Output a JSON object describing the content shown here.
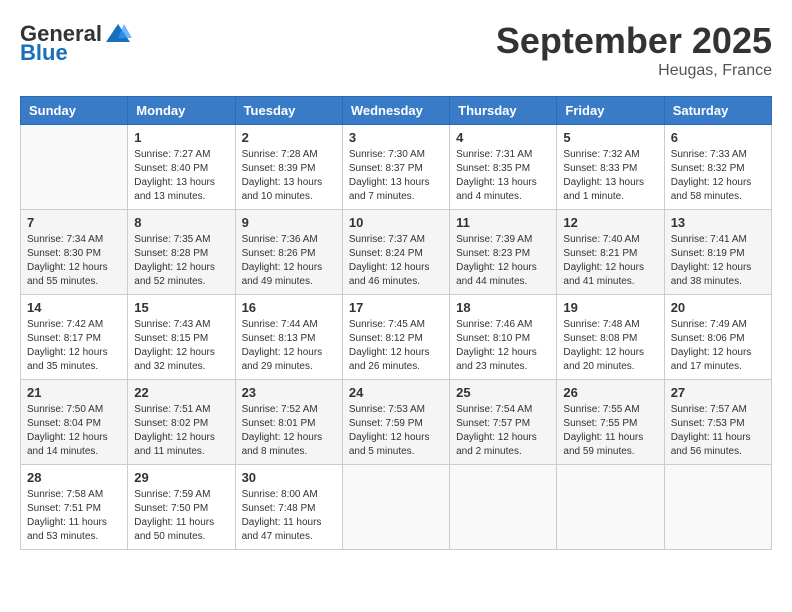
{
  "header": {
    "logo_general": "General",
    "logo_blue": "Blue",
    "month_title": "September 2025",
    "location": "Heugas, France"
  },
  "days_of_week": [
    "Sunday",
    "Monday",
    "Tuesday",
    "Wednesday",
    "Thursday",
    "Friday",
    "Saturday"
  ],
  "weeks": [
    [
      {
        "day": "",
        "info": ""
      },
      {
        "day": "1",
        "info": "Sunrise: 7:27 AM\nSunset: 8:40 PM\nDaylight: 13 hours\nand 13 minutes."
      },
      {
        "day": "2",
        "info": "Sunrise: 7:28 AM\nSunset: 8:39 PM\nDaylight: 13 hours\nand 10 minutes."
      },
      {
        "day": "3",
        "info": "Sunrise: 7:30 AM\nSunset: 8:37 PM\nDaylight: 13 hours\nand 7 minutes."
      },
      {
        "day": "4",
        "info": "Sunrise: 7:31 AM\nSunset: 8:35 PM\nDaylight: 13 hours\nand 4 minutes."
      },
      {
        "day": "5",
        "info": "Sunrise: 7:32 AM\nSunset: 8:33 PM\nDaylight: 13 hours\nand 1 minute."
      },
      {
        "day": "6",
        "info": "Sunrise: 7:33 AM\nSunset: 8:32 PM\nDaylight: 12 hours\nand 58 minutes."
      }
    ],
    [
      {
        "day": "7",
        "info": "Sunrise: 7:34 AM\nSunset: 8:30 PM\nDaylight: 12 hours\nand 55 minutes."
      },
      {
        "day": "8",
        "info": "Sunrise: 7:35 AM\nSunset: 8:28 PM\nDaylight: 12 hours\nand 52 minutes."
      },
      {
        "day": "9",
        "info": "Sunrise: 7:36 AM\nSunset: 8:26 PM\nDaylight: 12 hours\nand 49 minutes."
      },
      {
        "day": "10",
        "info": "Sunrise: 7:37 AM\nSunset: 8:24 PM\nDaylight: 12 hours\nand 46 minutes."
      },
      {
        "day": "11",
        "info": "Sunrise: 7:39 AM\nSunset: 8:23 PM\nDaylight: 12 hours\nand 44 minutes."
      },
      {
        "day": "12",
        "info": "Sunrise: 7:40 AM\nSunset: 8:21 PM\nDaylight: 12 hours\nand 41 minutes."
      },
      {
        "day": "13",
        "info": "Sunrise: 7:41 AM\nSunset: 8:19 PM\nDaylight: 12 hours\nand 38 minutes."
      }
    ],
    [
      {
        "day": "14",
        "info": "Sunrise: 7:42 AM\nSunset: 8:17 PM\nDaylight: 12 hours\nand 35 minutes."
      },
      {
        "day": "15",
        "info": "Sunrise: 7:43 AM\nSunset: 8:15 PM\nDaylight: 12 hours\nand 32 minutes."
      },
      {
        "day": "16",
        "info": "Sunrise: 7:44 AM\nSunset: 8:13 PM\nDaylight: 12 hours\nand 29 minutes."
      },
      {
        "day": "17",
        "info": "Sunrise: 7:45 AM\nSunset: 8:12 PM\nDaylight: 12 hours\nand 26 minutes."
      },
      {
        "day": "18",
        "info": "Sunrise: 7:46 AM\nSunset: 8:10 PM\nDaylight: 12 hours\nand 23 minutes."
      },
      {
        "day": "19",
        "info": "Sunrise: 7:48 AM\nSunset: 8:08 PM\nDaylight: 12 hours\nand 20 minutes."
      },
      {
        "day": "20",
        "info": "Sunrise: 7:49 AM\nSunset: 8:06 PM\nDaylight: 12 hours\nand 17 minutes."
      }
    ],
    [
      {
        "day": "21",
        "info": "Sunrise: 7:50 AM\nSunset: 8:04 PM\nDaylight: 12 hours\nand 14 minutes."
      },
      {
        "day": "22",
        "info": "Sunrise: 7:51 AM\nSunset: 8:02 PM\nDaylight: 12 hours\nand 11 minutes."
      },
      {
        "day": "23",
        "info": "Sunrise: 7:52 AM\nSunset: 8:01 PM\nDaylight: 12 hours\nand 8 minutes."
      },
      {
        "day": "24",
        "info": "Sunrise: 7:53 AM\nSunset: 7:59 PM\nDaylight: 12 hours\nand 5 minutes."
      },
      {
        "day": "25",
        "info": "Sunrise: 7:54 AM\nSunset: 7:57 PM\nDaylight: 12 hours\nand 2 minutes."
      },
      {
        "day": "26",
        "info": "Sunrise: 7:55 AM\nSunset: 7:55 PM\nDaylight: 11 hours\nand 59 minutes."
      },
      {
        "day": "27",
        "info": "Sunrise: 7:57 AM\nSunset: 7:53 PM\nDaylight: 11 hours\nand 56 minutes."
      }
    ],
    [
      {
        "day": "28",
        "info": "Sunrise: 7:58 AM\nSunset: 7:51 PM\nDaylight: 11 hours\nand 53 minutes."
      },
      {
        "day": "29",
        "info": "Sunrise: 7:59 AM\nSunset: 7:50 PM\nDaylight: 11 hours\nand 50 minutes."
      },
      {
        "day": "30",
        "info": "Sunrise: 8:00 AM\nSunset: 7:48 PM\nDaylight: 11 hours\nand 47 minutes."
      },
      {
        "day": "",
        "info": ""
      },
      {
        "day": "",
        "info": ""
      },
      {
        "day": "",
        "info": ""
      },
      {
        "day": "",
        "info": ""
      }
    ]
  ]
}
